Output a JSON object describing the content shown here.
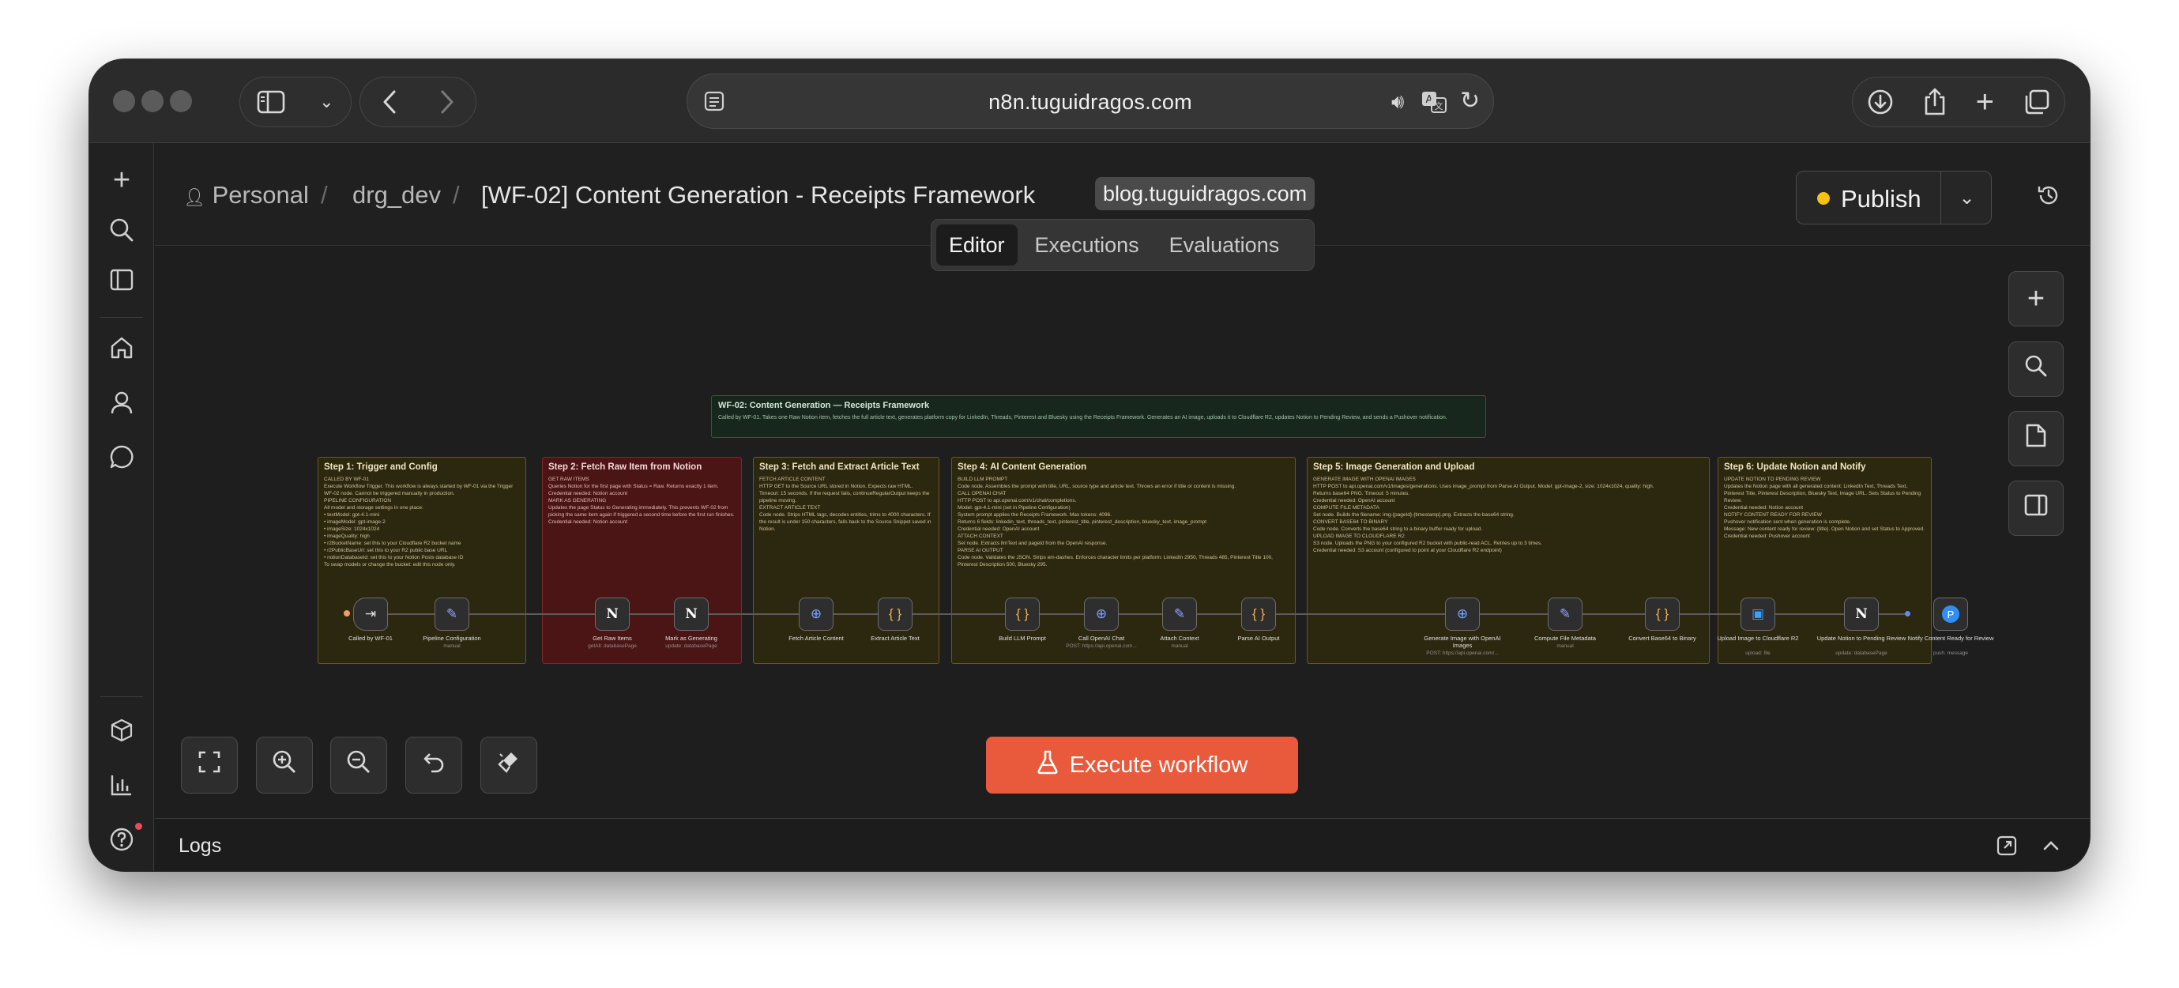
{
  "browser": {
    "url": "n8n.tuguidragos.com"
  },
  "breadcrumb": {
    "project": "Personal",
    "folder": "drg_dev",
    "workflow": "[WF-02] Content Generation - Receipts Framework",
    "tag": "blog.tuguidragos.com"
  },
  "header": {
    "publish_label": "Publish",
    "status_color": "#f5c211"
  },
  "tabs": [
    "Editor",
    "Executions",
    "Evaluations"
  ],
  "canvas": {
    "title_note": {
      "title": "WF-02: Content Generation — Receipts Framework",
      "body": "Called by WF-01. Takes one Raw Notion item, fetches the full article text, generates platform copy for LinkedIn, Threads, Pinterest and Bluesky using the Receipts Framework. Generates an AI image, uploads it to Cloudflare R2, updates Notion to Pending Review, and sends a Pushover notification."
    },
    "sticky_notes": [
      {
        "title": "Step 1: Trigger and Config",
        "body": "CALLED BY WF-01\nExecute Workflow Trigger. This workflow is always started by WF-01 via the Trigger WF-02 node. Cannot be triggered manually in production.\nPIPELINE CONFIGURATION\nAll model and storage settings in one place:\n• textModel: gpt-4.1-mini\n• imageModel: gpt-image-2\n• imageSize: 1024x1024\n• imageQuality: high\n• r2BucketName: set this to your Cloudflare R2 bucket name\n• r2PublicBaseUrl: set this to your R2 public base URL\n• notionDatabaseId: set this to your Notion Posts database ID\nTo swap models or change the bucket: edit this node only."
      },
      {
        "title": "Step 2: Fetch Raw Item from Notion",
        "body": "GET RAW ITEMS\nQueries Notion for the first page with Status = Raw. Returns exactly 1 item.\nCredential needed: Notion account\nMARK AS GENERATING\nUpdates the page Status to Generating immediately. This prevents WF-02 from picking the same item again if triggered a second time before the first run finishes.\nCredential needed: Notion account"
      },
      {
        "title": "Step 3: Fetch and Extract Article Text",
        "body": "FETCH ARTICLE CONTENT\nHTTP GET to the Source URL stored in Notion. Expects raw HTML. Timeout: 15 seconds. If the request fails, continueRegularOutput keeps the pipeline moving.\nEXTRACT ARTICLE TEXT\nCode node. Strips HTML tags, decodes entities, trims to 4000 characters. If the result is under 150 characters, falls back to the Source Snippet saved in Notion."
      },
      {
        "title": "Step 4: AI Content Generation",
        "body": "BUILD LLM PROMPT\nCode node. Assembles the prompt with title, URL, source type and article text. Throws an error if title or content is missing.\nCALL OPENAI CHAT\nHTTP POST to api.openai.com/v1/chat/completions.\nModel: gpt-4.1-mini (set in Pipeline Configuration)\nSystem prompt applies the Receipts Framework. Max tokens: 4096.\nReturns 6 fields: linkedin_text, threads_text, pinterest_title, pinterest_description, bluesky_text, image_prompt\nCredential needed: OpenAI account\nATTACH CONTEXT\nSet node. Extracts llmText and pageId from the OpenAI response.\nPARSE AI OUTPUT\nCode node. Validates the JSON. Strips em-dashes. Enforces character limits per platform: LinkedIn 2950, Threads 485, Pinterest Title 100, Pinterest Description 500, Bluesky 295."
      },
      {
        "title": "Step 5: Image Generation and Upload",
        "body": "GENERATE IMAGE WITH OPENAI IMAGES\nHTTP POST to api.openai.com/v1/images/generations. Uses image_prompt from Parse AI Output. Model: gpt-image-2, size: 1024x1024, quality: high.\nReturns base64 PNG. Timeout: 5 minutes.\nCredential needed: OpenAI account\nCOMPUTE FILE METADATA\nSet node. Builds the filename: img-{pageId}-{timestamp}.png. Extracts the base64 string.\nCONVERT BASE64 TO BINARY\nCode node. Converts the base64 string to a binary buffer ready for upload.\nUPLOAD IMAGE TO CLOUDFLARE R2\nS3 node. Uploads the PNG to your configured R2 bucket with public-read ACL. Retries up to 3 times.\nCredential needed: S3 account (configured to point at your Cloudflare R2 endpoint)"
      },
      {
        "title": "Step 6: Update Notion and Notify",
        "body": "UPDATE NOTION TO PENDING REVIEW\nUpdates the Notion page with all generated content: LinkedIn Text, Threads Text, Pinterest Title, Pinterest Description, Bluesky Text, Image URL. Sets Status to Pending Review.\nCredential needed: Notion account\nNOTIFY CONTENT READY FOR REVIEW\nPushover notification sent when generation is complete.\nMessage: New content ready for review: {title}. Open Notion and set Status to Approved.\nCredential needed: Pushover account"
      }
    ],
    "nodes": [
      {
        "label": "Called by WF-01",
        "sub": "",
        "icon": "⇥",
        "kind": "trig"
      },
      {
        "label": "Pipeline Configuration",
        "sub": "manual",
        "icon": "✎",
        "kind": "set"
      },
      {
        "label": "Get Raw Items",
        "sub": "getAll: databasePage",
        "icon": "N",
        "kind": "notion"
      },
      {
        "label": "Mark as Generating",
        "sub": "update: databasePage",
        "icon": "N",
        "kind": "notion"
      },
      {
        "label": "Fetch Article Content",
        "sub": "",
        "icon": "⊕",
        "kind": "http"
      },
      {
        "label": "Extract Article Text",
        "sub": "",
        "icon": "{ }",
        "kind": "code"
      },
      {
        "label": "Build LLM Prompt",
        "sub": "",
        "icon": "{ }",
        "kind": "code"
      },
      {
        "label": "Call OpenAI Chat",
        "sub": "POST: https://api.openai.com...",
        "icon": "⊕",
        "kind": "http"
      },
      {
        "label": "Attach Context",
        "sub": "manual",
        "icon": "✎",
        "kind": "set"
      },
      {
        "label": "Parse AI Output",
        "sub": "",
        "icon": "{ }",
        "kind": "code"
      },
      {
        "label": "Generate Image with OpenAI Images",
        "sub": "POST: https://api.openai.com/...",
        "icon": "⊕",
        "kind": "http"
      },
      {
        "label": "Compute File Metadata",
        "sub": "manual",
        "icon": "✎",
        "kind": "set"
      },
      {
        "label": "Convert Base64 to Binary",
        "sub": "",
        "icon": "{ }",
        "kind": "code"
      },
      {
        "label": "Upload Image to Cloudflare R2",
        "sub": "upload: file",
        "icon": "▣",
        "kind": "r2"
      },
      {
        "label": "Update Notion to Pending Review",
        "sub": "update: databasePage",
        "icon": "N",
        "kind": "notion"
      },
      {
        "label": "Notify Content Ready for Review",
        "sub": "push: message",
        "icon": "P",
        "kind": "push"
      }
    ],
    "execute_label": "Execute workflow"
  },
  "logs": {
    "label": "Logs"
  },
  "icons": {
    "rail": [
      "plus-icon",
      "search-icon",
      "panel-icon",
      "home-icon",
      "user-icon",
      "chat-icon",
      "cube-icon",
      "chart-icon",
      "help-icon",
      "gear-icon"
    ],
    "canvas_right": [
      "plus-icon",
      "search-icon",
      "note-icon",
      "sidebar-icon"
    ],
    "canvas_bottom": [
      "fit-view-icon",
      "zoom-in-icon",
      "zoom-out-icon",
      "undo-icon",
      "tidy-icon"
    ]
  }
}
